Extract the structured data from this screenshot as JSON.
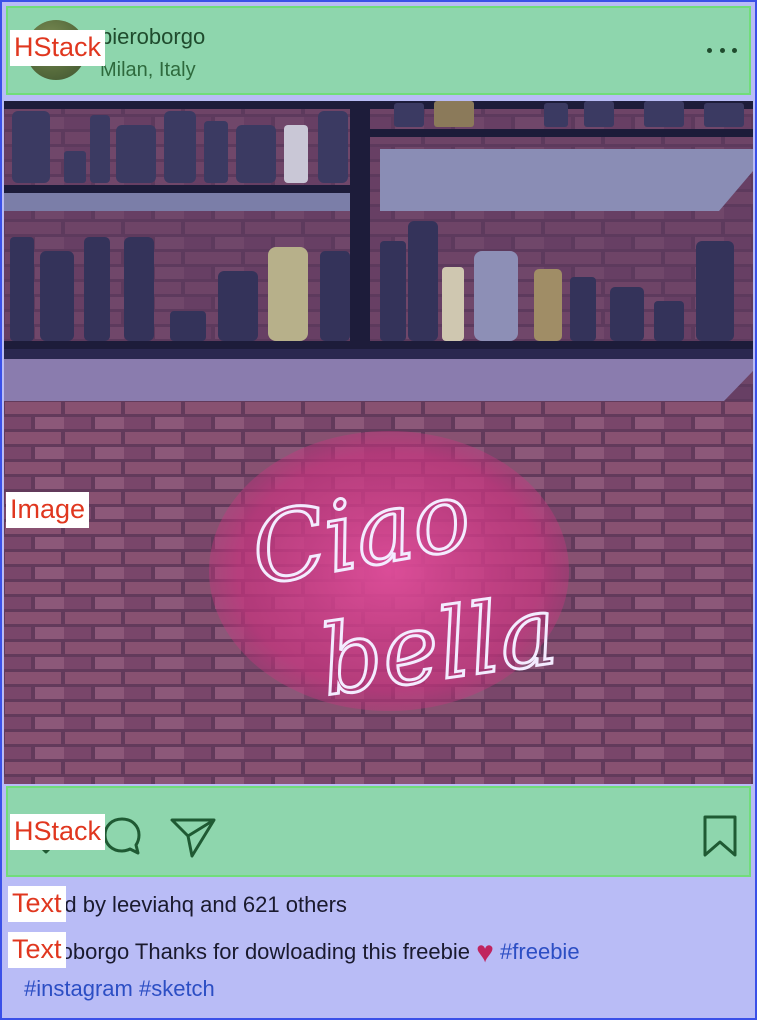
{
  "post": {
    "username": "pieroborgo",
    "location": "Milan, Italy",
    "likes_text": "Liked by leeviahq and 621 others",
    "caption": {
      "username": "pieroborgo",
      "text": " Thanks for dowloading this freebie ",
      "heart": "♥",
      "tag_1": "#freebie",
      "tag_2": "#instagram",
      "tag_3": "#sketch"
    },
    "image_sign": {
      "line1": "Ciao",
      "line2": "bella"
    }
  },
  "overlay_labels": {
    "header": "HStack",
    "image": "Image",
    "actions": "HStack",
    "likes": "Text",
    "caption": "Text"
  },
  "icons": {
    "more": "more-horizontal-icon",
    "like": "heart-icon",
    "comment": "comment-icon",
    "share": "send-icon",
    "save": "bookmark-icon"
  },
  "colors": {
    "frame_border": "#3a50e8",
    "frame_fill": "#b9bcf6",
    "stack_fill": "#8ed6ad",
    "stack_border": "#71dd7a",
    "label_text": "#e0371f",
    "hashtag": "#2c4ec4"
  }
}
